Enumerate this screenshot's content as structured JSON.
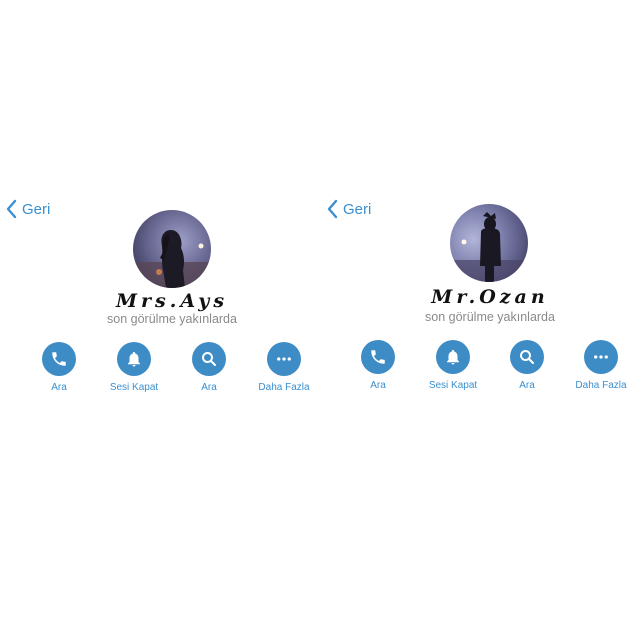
{
  "colors": {
    "accent": "#3a8fd0",
    "button": "#3e8cc6",
    "status_text": "#8a8a8a",
    "name_text": "#111111"
  },
  "panels": [
    {
      "back_label": "Geri",
      "name": "Mrs.Ays",
      "status": "son görülme yakınlarda",
      "avatar": "profile-photo",
      "actions": [
        {
          "label": "Ara",
          "icon": "phone-icon"
        },
        {
          "label": "Sesi Kapat",
          "icon": "bell-icon"
        },
        {
          "label": "Ara",
          "icon": "search-icon"
        },
        {
          "label": "Daha Fazla",
          "icon": "more-icon"
        }
      ]
    },
    {
      "back_label": "Geri",
      "name": "Mr.Ozan",
      "status": "son görülme yakınlarda",
      "avatar": "profile-photo",
      "actions": [
        {
          "label": "Ara",
          "icon": "phone-icon"
        },
        {
          "label": "Sesi Kapat",
          "icon": "bell-icon"
        },
        {
          "label": "Ara",
          "icon": "search-icon"
        },
        {
          "label": "Daha Fazla",
          "icon": "more-icon"
        }
      ]
    }
  ]
}
